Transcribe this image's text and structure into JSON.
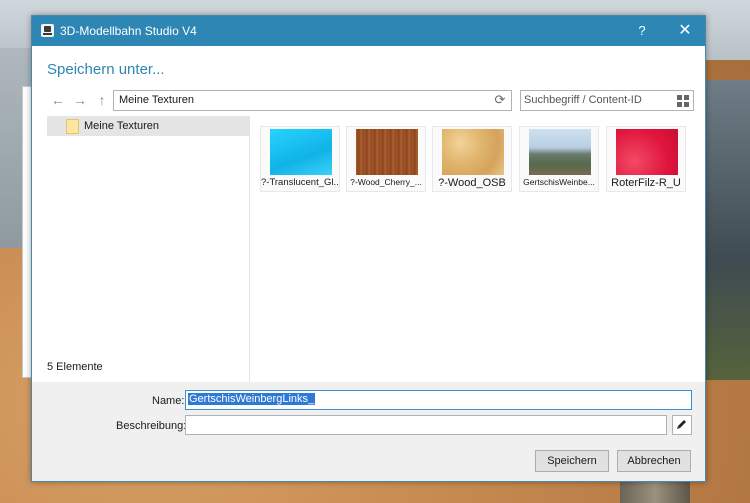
{
  "window": {
    "title": "3D-Modellbahn Studio V4",
    "help_label": "?",
    "close_label": "✕"
  },
  "dialog": {
    "heading": "Speichern unter...",
    "path": "Meine Texturen",
    "search_placeholder": "Suchbegriff / Content-ID"
  },
  "tree": {
    "items": [
      {
        "label": "Meine Texturen"
      }
    ]
  },
  "files": [
    {
      "label": "?-Translucent_Gl...",
      "color": "#19c3ef"
    },
    {
      "label": "?-Wood_Cherry_...",
      "color": "#9b4e23"
    },
    {
      "label": "?-Wood_OSB",
      "color": "#e0b873"
    },
    {
      "label": "GertschisWeinbe...",
      "color": "#7a8fa0"
    },
    {
      "label": "RoterFilz-R_U",
      "color": "#e0153d"
    }
  ],
  "status": {
    "count": "5 Elemente"
  },
  "form": {
    "name_label": "Name:",
    "name_value": "GertschisWeinbergLinks_",
    "description_label": "Beschreibung:",
    "description_value": ""
  },
  "buttons": {
    "save": "Speichern",
    "cancel": "Abbrechen"
  },
  "colors": {
    "titlebar": "#2d86b3",
    "heading": "#2d86b3",
    "selection": "#2f79d6"
  },
  "icons": {
    "back": "←",
    "forward": "→",
    "up": "↑",
    "refresh": "⟳",
    "pen": "✎"
  }
}
